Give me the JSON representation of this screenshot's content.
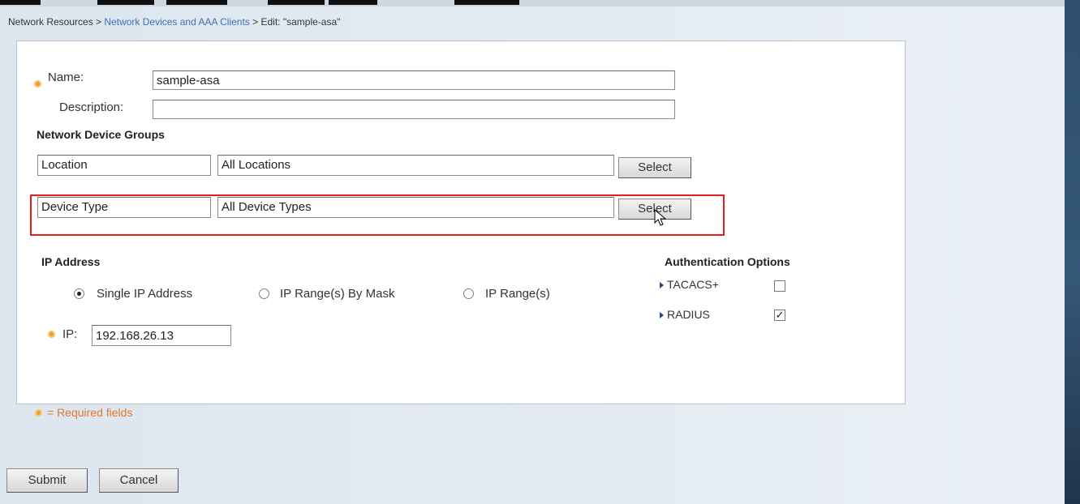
{
  "breadcrumb": {
    "root": "Network Resources",
    "sep1": " > ",
    "section": "Network Devices and AAA Clients",
    "sep2": " > ",
    "current": "Edit: \"sample-asa\""
  },
  "form": {
    "name_label": "Name:",
    "name_value": "sample-asa",
    "description_label": "Description:",
    "description_value": ""
  },
  "ndg": {
    "heading": "Network Device Groups",
    "rows": [
      {
        "group": "Location",
        "value": "All Locations",
        "button": "Select"
      },
      {
        "group": "Device Type",
        "value": "All Device Types",
        "button": "Select"
      }
    ]
  },
  "ip": {
    "heading": "IP Address",
    "options": [
      {
        "label": "Single IP Address",
        "selected": true
      },
      {
        "label": "IP Range(s) By Mask",
        "selected": false
      },
      {
        "label": "IP Range(s)",
        "selected": false
      }
    ],
    "ip_label": "IP:",
    "ip_value": "192.168.26.13"
  },
  "auth": {
    "heading": "Authentication Options",
    "items": [
      {
        "label": "TACACS+",
        "checked": false
      },
      {
        "label": "RADIUS",
        "checked": true
      }
    ]
  },
  "required_note": "= Required fields",
  "actions": {
    "submit": "Submit",
    "cancel": "Cancel"
  },
  "colors": {
    "required_marker": "#f09a1e",
    "highlight_border": "#e02020",
    "link": "#3a6fb3",
    "required_text": "#e8762c"
  }
}
